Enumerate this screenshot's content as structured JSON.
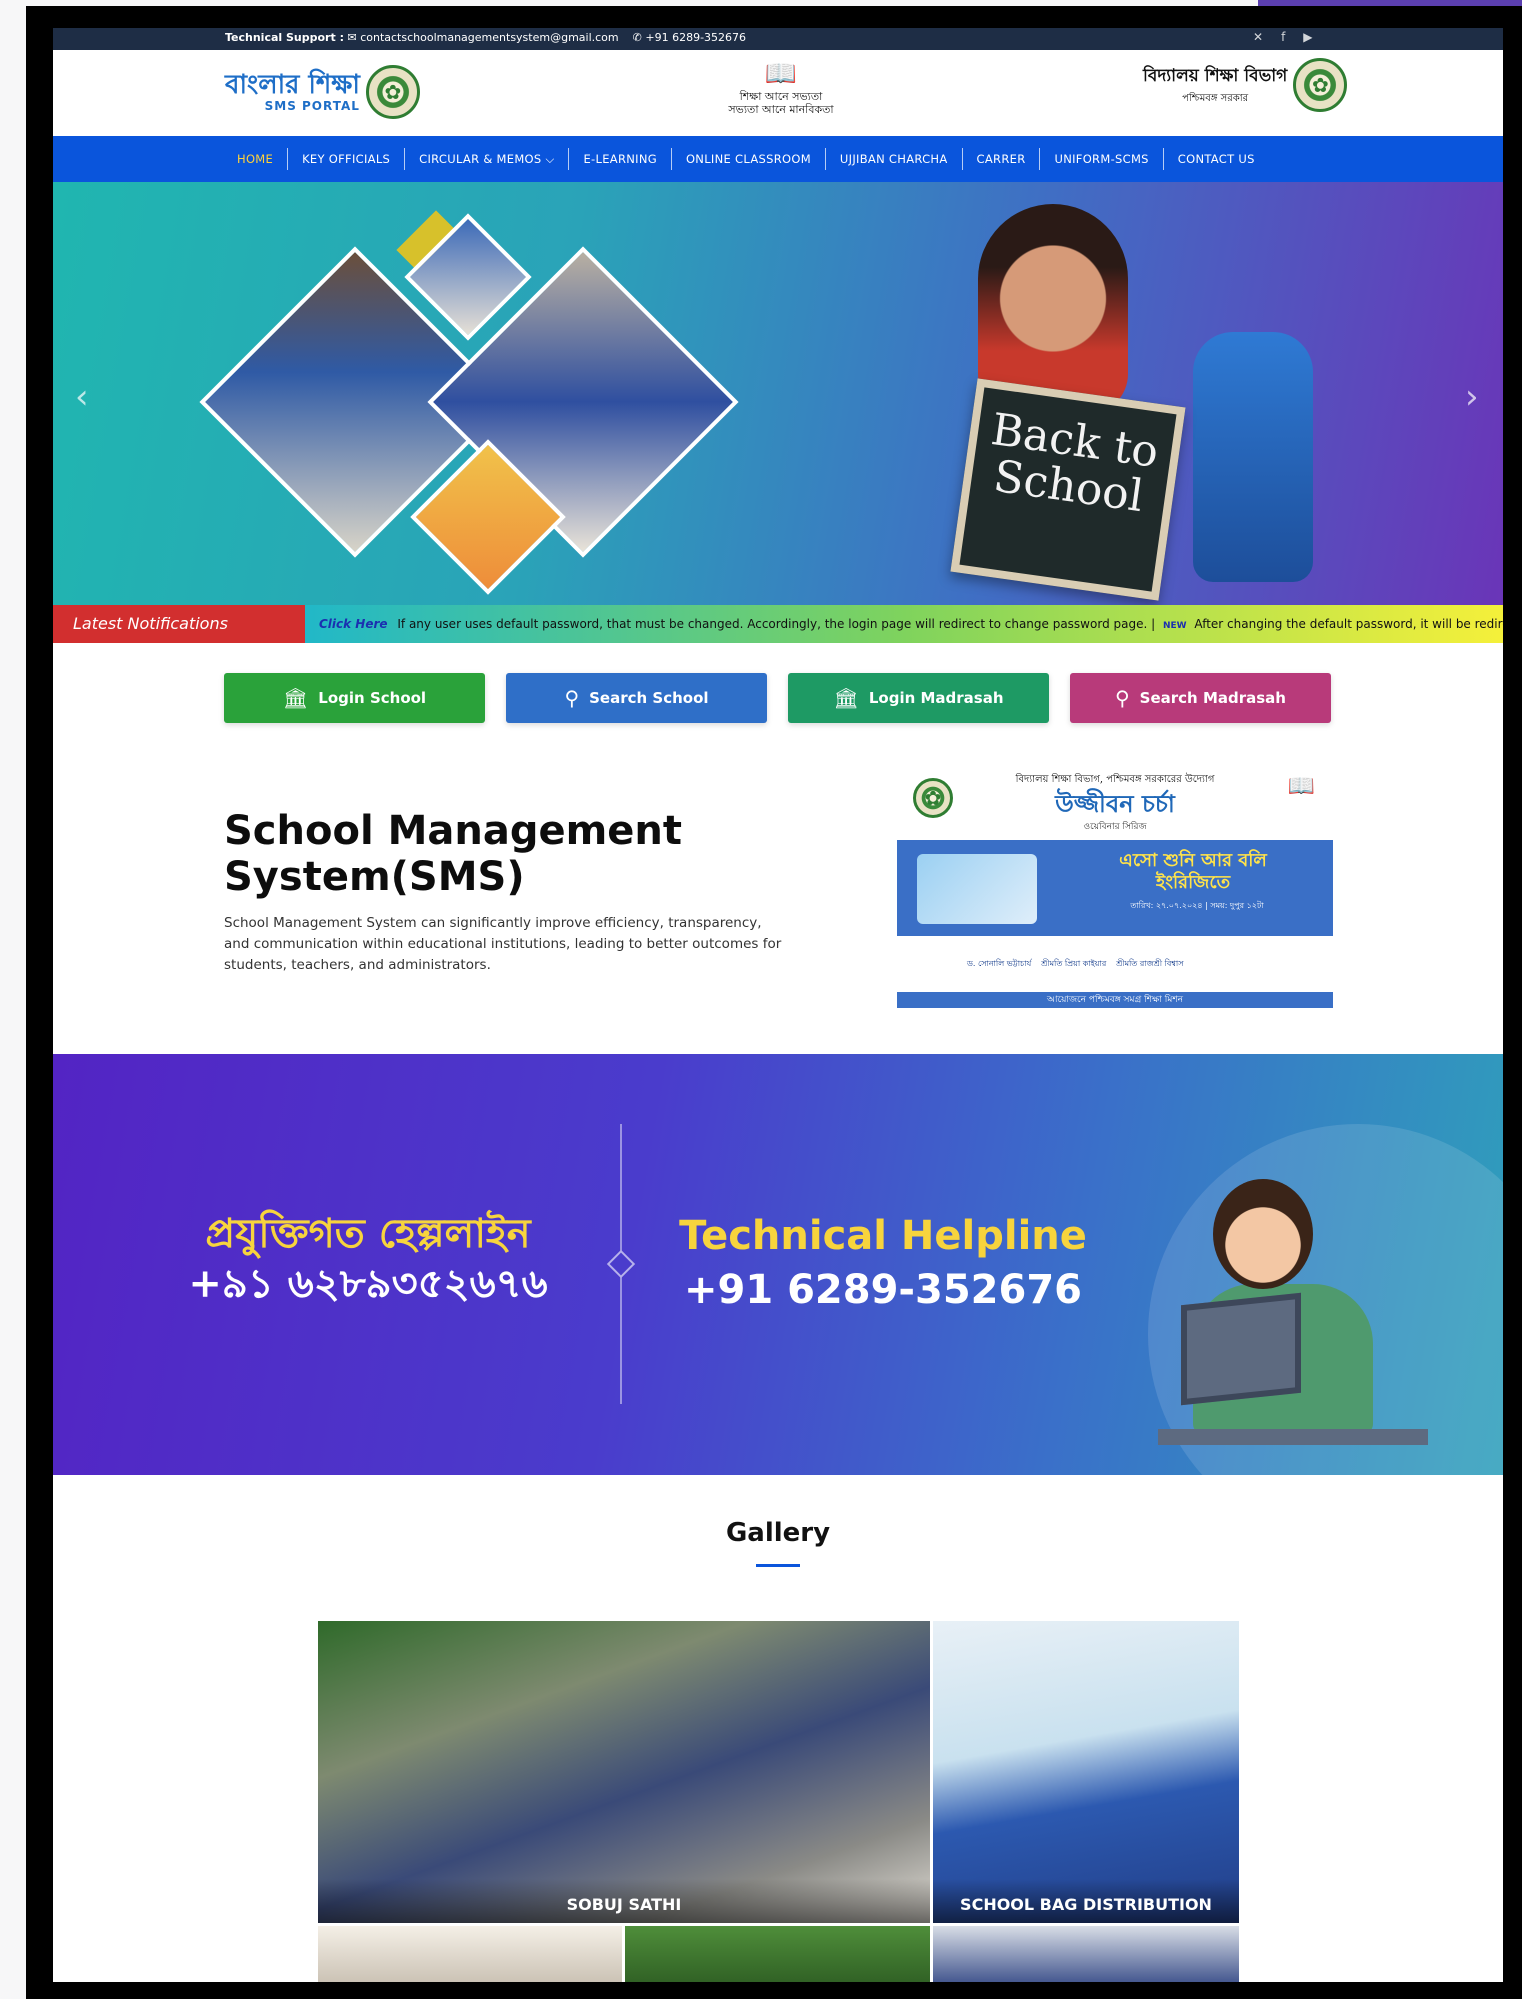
{
  "top_strip": {
    "label": "Technical Support :",
    "email": "contactschoolmanagementsystem@gmail.com",
    "phone": "+91 6289-352676",
    "social_icons": [
      "x-icon",
      "facebook-icon",
      "youtube-icon"
    ]
  },
  "header": {
    "left_logo_title": "বাংলার শিক্ষা",
    "left_logo_subtitle": "SMS PORTAL",
    "center_logo_line1": "শিক্ষা আনে সভ্যতা",
    "center_logo_line2": "সভ্যতা আনে মানবিকতা",
    "right_logo_title": "বিদ্যালয় শিক্ষা বিভাগ",
    "right_logo_subtitle": "পশ্চিমবঙ্গ সরকার"
  },
  "nav": {
    "items": [
      "HOME",
      "KEY OFFICIALS",
      "CIRCULAR & MEMOS ⌵",
      "E-LEARNING",
      "ONLINE CLASSROOM",
      "UJJIBAN CHARCHA",
      "CARRER",
      "UNIFORM-SCMS",
      "CONTACT US"
    ],
    "active": "HOME"
  },
  "hero": {
    "chalkboard_text": "Back to School",
    "prev_arrow": "‹",
    "next_arrow": "›"
  },
  "notifications": {
    "label": "Latest Notifications",
    "click_here": "Click Here",
    "text1": "If any user uses default password, that must be changed. Accordingly, the login page will redirect to change password page. |",
    "new_badge": "NEW",
    "text2": "After changing the default password, it will be redire"
  },
  "actions": [
    {
      "label": "Login School",
      "icon": "🏛",
      "color": "#2aa23a"
    },
    {
      "label": "Search School",
      "icon": "⚲",
      "color": "#2f6fc8"
    },
    {
      "label": "Login Madrasah",
      "icon": "🏛",
      "color": "#1e9a64"
    },
    {
      "label": "Search Madrasah",
      "icon": "⚲",
      "color": "#b83a7a"
    }
  ],
  "sms": {
    "title": "School Management System(SMS)",
    "description": "School Management System can significantly improve efficiency, transparency, and communication within educational institutions, leading to better outcomes for students, teachers, and administrators."
  },
  "poster": {
    "dept": "বিদ্যালয় শিক্ষা বিভাগ, পশ্চিমবঙ্গ সরকারের উদ্যোগ",
    "title": "উজ্জীবন চর্চা",
    "series": "ওয়েবিনার সিরিজ",
    "band_title": "এসো শুনি আর বলি ইংরিজিতে",
    "band_date": "তারিখ: ২৭.০৭.২০২৪ | সময়: দুপুর ১২টা",
    "speaker1": "ড. সোনালি ভট্টাচার্য",
    "speaker2": "শ্রীমতি প্রিয়া কাইয়ার",
    "speaker3": "শ্রীমতি রাজশ্রী বিশ্বাস",
    "footer": "আয়োজনে পশ্চিমবঙ্গ সমগ্র শিক্ষা মিশন"
  },
  "helpline": {
    "bn_title": "প্রযুক্তিগত হেল্পলাইন",
    "bn_number": "+৯১ ৬২৮৯৩৫২৬৭৬",
    "en_title": "Technical Helpline",
    "en_number": "+91 6289-352676"
  },
  "gallery": {
    "title": "Gallery",
    "items": [
      {
        "caption": "SOBUJ SATHI"
      },
      {
        "caption": "SCHOOL BAG DISTRIBUTION"
      },
      {
        "caption": ""
      },
      {
        "caption": ""
      },
      {
        "caption": ""
      }
    ]
  }
}
